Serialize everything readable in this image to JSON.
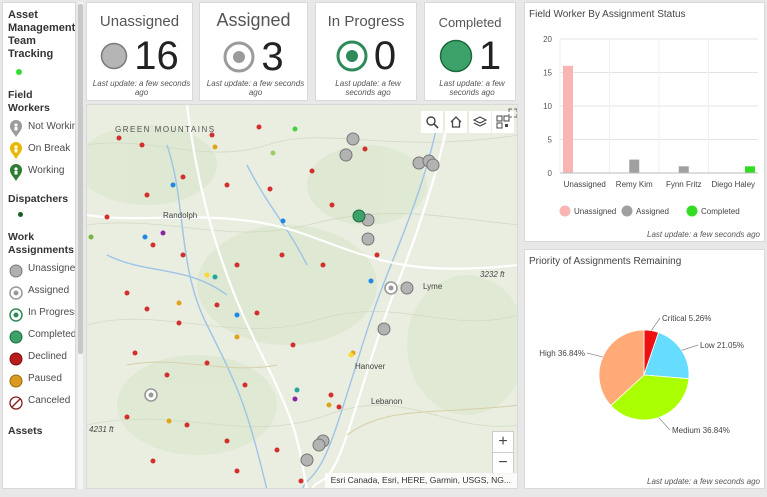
{
  "legend": {
    "title": "Asset Management Team Tracking",
    "field_workers_heading": "Field Workers",
    "field_workers": [
      {
        "label": "Not Working",
        "color": "#9b9b9b",
        "icon": "pin-person-icon"
      },
      {
        "label": "On Break",
        "color": "#e8b800",
        "icon": "pin-person-icon"
      },
      {
        "label": "Working",
        "color": "#2e7d32",
        "icon": "pin-person-icon"
      }
    ],
    "dispatchers_heading": "Dispatchers",
    "dispatcher_color": "#1b5e20",
    "work_assignments_heading": "Work Assignments",
    "work_assignments": [
      {
        "label": "Unassigned",
        "icon": "gray-circle-icon"
      },
      {
        "label": "Assigned",
        "icon": "ring-circle-icon"
      },
      {
        "label": "In Progress",
        "icon": "green-ring-circle-icon"
      },
      {
        "label": "Completed",
        "icon": "green-circle-icon"
      },
      {
        "label": "Declined",
        "icon": "red-circle-icon"
      },
      {
        "label": "Paused",
        "icon": "orange-circle-icon"
      },
      {
        "label": "Canceled",
        "icon": "canceled-icon"
      }
    ],
    "assets_heading": "Assets",
    "title_dot_color": "#33dd33"
  },
  "indicators": [
    {
      "name": "Unassigned",
      "value": "16",
      "update": "Last update: a few seconds ago"
    },
    {
      "name": "Assigned",
      "value": "3",
      "update": "Last update: a few seconds ago"
    },
    {
      "name": "In Progress",
      "value": "0",
      "update": "Last update: a few seconds ago"
    },
    {
      "name": "Completed",
      "value": "1",
      "update": "Last update: a few seconds ago"
    }
  ],
  "map": {
    "labels": {
      "green_mountains": "GREEN MOUNTAINS",
      "randolph": "Randolph",
      "lyme": "Lyme",
      "hanover": "Hanover",
      "lebanon": "Lebanon",
      "elev1": "3232 ft",
      "elev2": "4231 ft"
    },
    "attribution": "Esri Canada, Esri, HERE, Garmin, USGS, NG...",
    "zoom_in": "+",
    "zoom_out": "−"
  },
  "bar_chart": {
    "title": "Field Worker By Assignment Status",
    "update": "Last update: a few seconds ago",
    "chart_data": {
      "type": "bar",
      "categories": [
        "Unassigned",
        "Remy Kim",
        "Fynn Fritz",
        "Diego Haley"
      ],
      "series": [
        {
          "name": "Unassigned",
          "color": "#f9b4b4",
          "values": [
            16,
            0,
            0,
            0
          ]
        },
        {
          "name": "Assigned",
          "color": "#a0a0a0",
          "values": [
            0,
            2,
            1,
            0
          ]
        },
        {
          "name": "Completed",
          "color": "#33dd22",
          "values": [
            0,
            0,
            0,
            1
          ]
        }
      ],
      "ylim": [
        0,
        20
      ],
      "yticks": [
        0,
        5,
        10,
        15,
        20
      ],
      "grid": true,
      "legend": "bottom"
    }
  },
  "pie_chart": {
    "title": "Priority of Assignments Remaining",
    "update": "Last update: a few seconds ago",
    "chart_data": {
      "type": "pie",
      "slices": [
        {
          "label": "Critical",
          "value": 5.26,
          "text": "Critical 5.26%",
          "color": "#ee1111"
        },
        {
          "label": "Low",
          "value": 21.05,
          "text": "Low 21.05%",
          "color": "#66ddff"
        },
        {
          "label": "Medium",
          "value": 36.84,
          "text": "Medium 36.84%",
          "color": "#aaff00"
        },
        {
          "label": "High",
          "value": 36.84,
          "text": "High 36.84%",
          "color": "#ffaa77"
        }
      ]
    }
  }
}
